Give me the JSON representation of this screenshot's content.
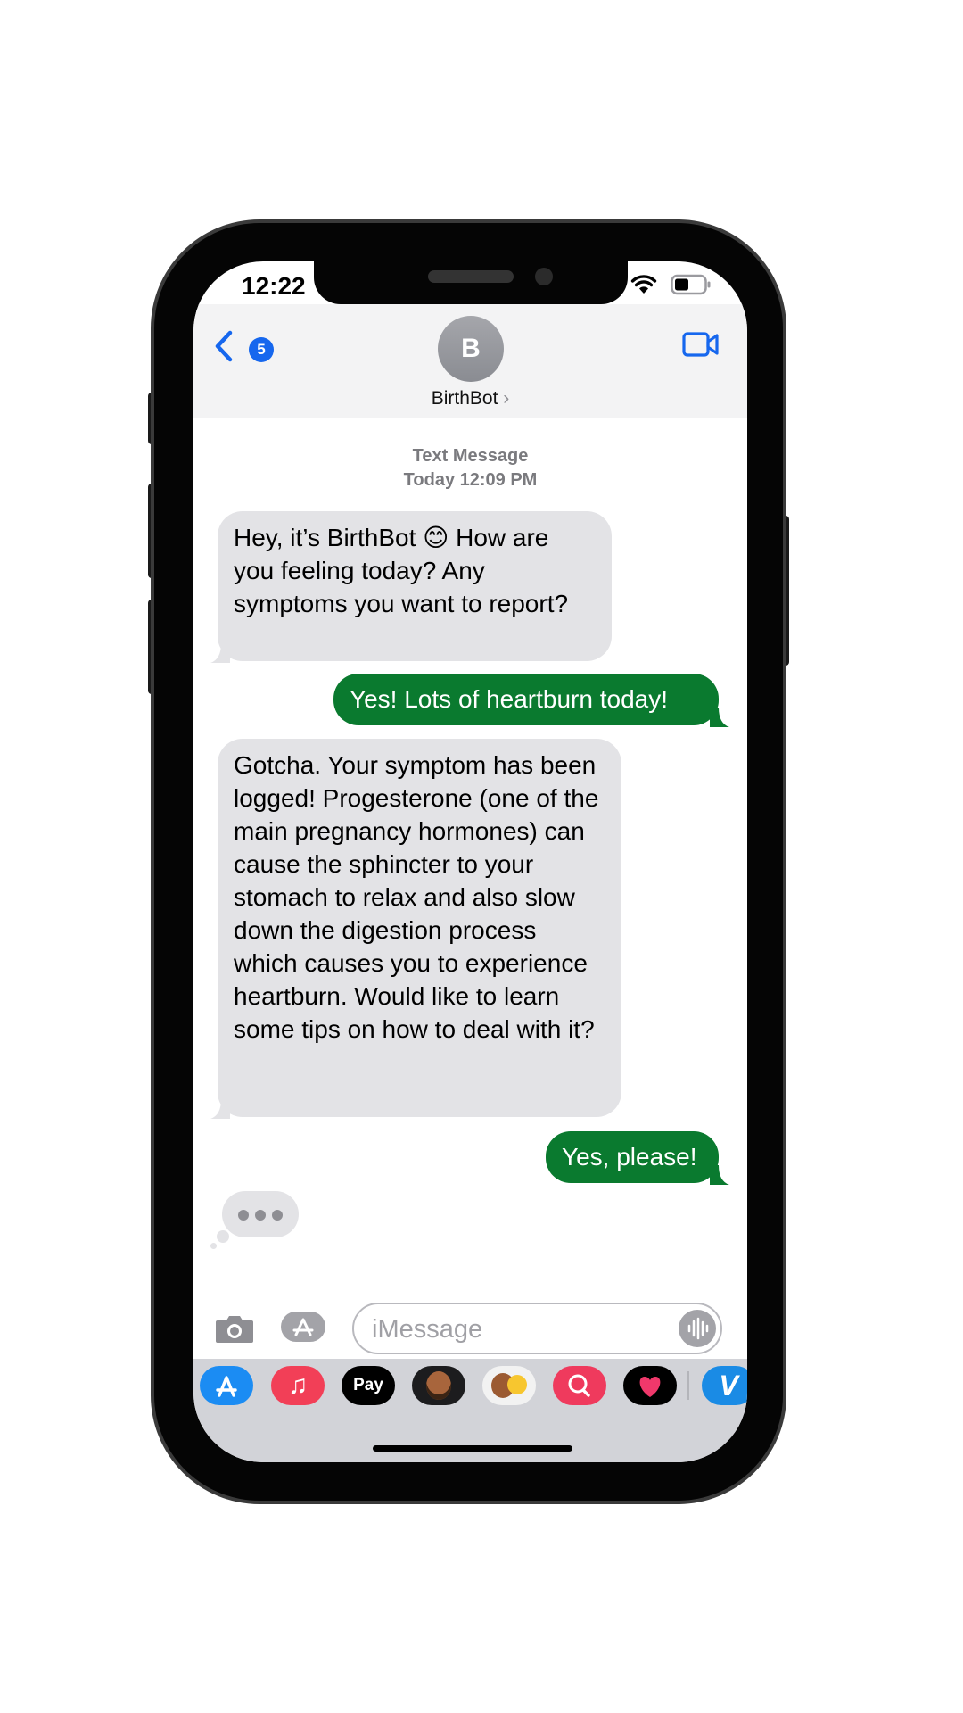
{
  "status_bar": {
    "time": "12:22"
  },
  "header": {
    "back_badge": "5",
    "avatar_initial": "B",
    "contact_name": "BirthBot",
    "contact_chevron": "›"
  },
  "thread": {
    "service": "Text Message",
    "timestamp": "Today 12:09 PM"
  },
  "messages": [
    {
      "sender": "bot",
      "text": "Hey, it’s BirthBot 😊 How are you feeling today? Any symptoms you want to report?"
    },
    {
      "sender": "user",
      "text": "Yes! Lots of heartburn today!"
    },
    {
      "sender": "bot",
      "text": "Gotcha. Your symptom has been logged! Progesterone (one of the main pregnancy hormones) can cause the sphincter to your stomach to relax and also slow down the digestion process which causes you to experience heartburn. Would like to learn some tips on how to deal with it?"
    },
    {
      "sender": "user",
      "text": "Yes, please!"
    }
  ],
  "input": {
    "placeholder": "iMessage"
  },
  "apps": [
    {
      "name": "app-store",
      "label": "A"
    },
    {
      "name": "music",
      "label": "♫"
    },
    {
      "name": "apple-pay",
      "label": "Pay"
    },
    {
      "name": "memoji",
      "label": ""
    },
    {
      "name": "memoji-stickers",
      "label": ""
    },
    {
      "name": "image-search",
      "label": ""
    },
    {
      "name": "digital-touch",
      "label": ""
    },
    {
      "name": "venmo",
      "label": "V"
    }
  ],
  "colors": {
    "outgoing_bubble": "#0a7a2f",
    "incoming_bubble": "#e3e3e6",
    "accent": "#1667ee"
  }
}
